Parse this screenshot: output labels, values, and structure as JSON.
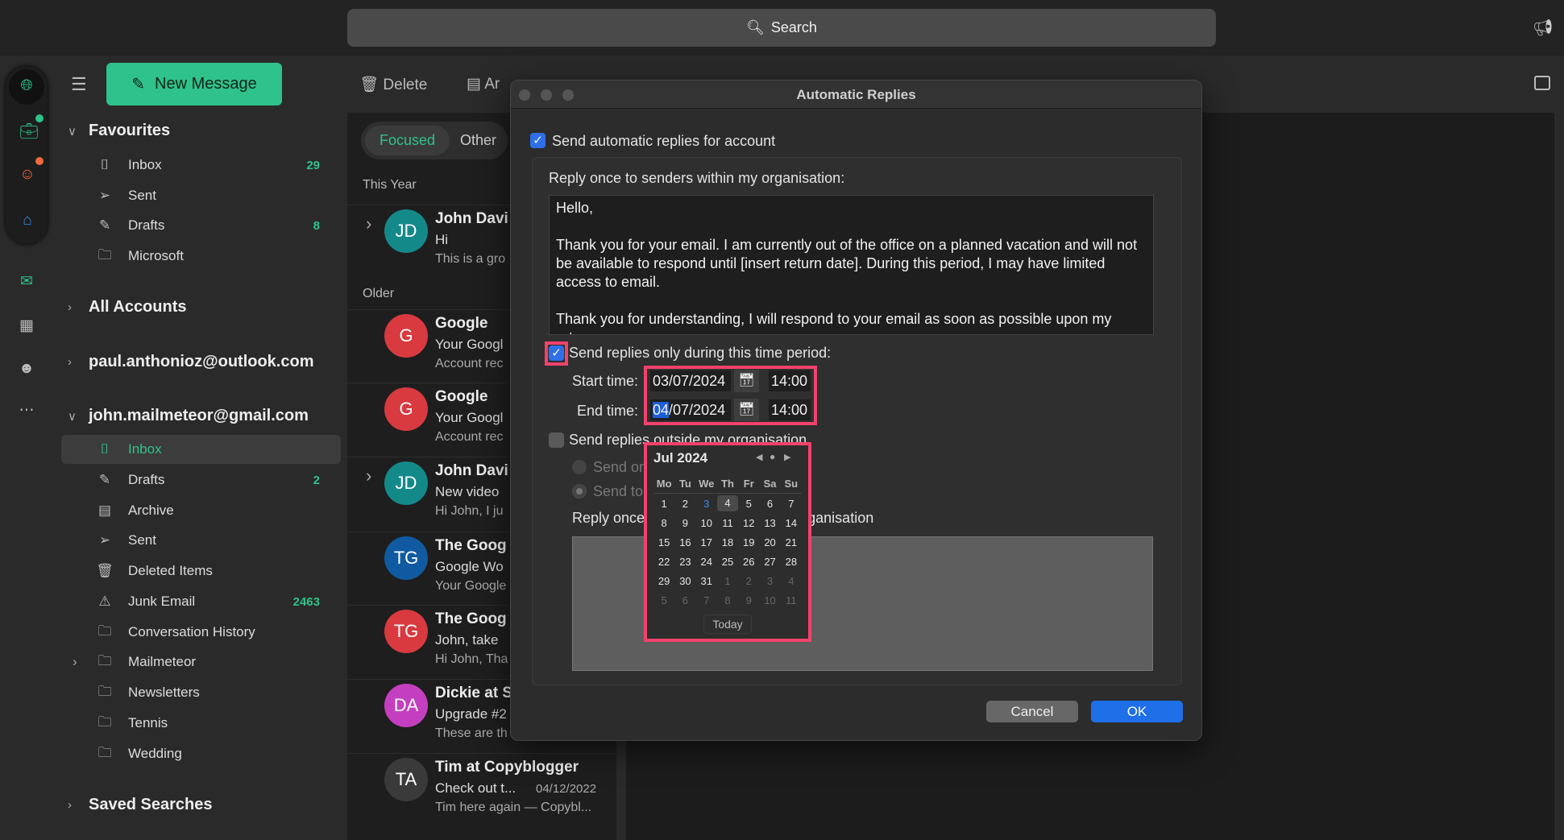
{
  "search": {
    "placeholder": "Search"
  },
  "rail": {
    "items": [
      "globe-icon",
      "briefcase-icon",
      "person-icon",
      "home-icon",
      "mail-icon",
      "calendar-icon",
      "people-icon",
      "more-icon"
    ]
  },
  "sidebar": {
    "new_message": "New Message",
    "favourites": {
      "label": "Favourites",
      "items": [
        {
          "label": "Inbox",
          "count": "29",
          "icon": "inbox-icon"
        },
        {
          "label": "Sent",
          "count": "",
          "icon": "sent-icon"
        },
        {
          "label": "Drafts",
          "count": "8",
          "icon": "drafts-icon"
        },
        {
          "label": "Microsoft",
          "count": "",
          "icon": "folder-icon"
        }
      ]
    },
    "all_accounts": "All Accounts",
    "account1": "paul.anthonioz@outlook.com",
    "account2": {
      "label": "john.mailmeteor@gmail.com",
      "items": [
        {
          "label": "Inbox",
          "count": "",
          "icon": "inbox-icon",
          "active": true
        },
        {
          "label": "Drafts",
          "count": "2",
          "icon": "drafts-icon"
        },
        {
          "label": "Archive",
          "count": "",
          "icon": "archive-icon"
        },
        {
          "label": "Sent",
          "count": "",
          "icon": "sent-icon"
        },
        {
          "label": "Deleted Items",
          "count": "",
          "icon": "trash-icon"
        },
        {
          "label": "Junk Email",
          "count": "2463",
          "icon": "junk-icon"
        },
        {
          "label": "Conversation History",
          "count": "",
          "icon": "folder-icon"
        },
        {
          "label": "Mailmeteor",
          "count": "",
          "icon": "folder-icon",
          "expandable": true
        },
        {
          "label": "Newsletters",
          "count": "",
          "icon": "folder-icon"
        },
        {
          "label": "Tennis",
          "count": "",
          "icon": "folder-icon"
        },
        {
          "label": "Wedding",
          "count": "",
          "icon": "folder-icon"
        }
      ]
    },
    "saved_searches": "Saved Searches"
  },
  "toolbar": {
    "delete": "Delete",
    "archive": "Ar"
  },
  "list": {
    "tabs": [
      "Focused",
      "Other"
    ],
    "sections": [
      "This Year",
      "Older"
    ],
    "messages": [
      {
        "initials": "JD",
        "color": "#14898a",
        "sender": "John Davi",
        "subject": "Hi",
        "preview": "This is a gro",
        "thread": true
      },
      {
        "initials": "G",
        "color": "#d83a3f",
        "sender": "Google",
        "subject": "Your Googl",
        "preview": "Account rec"
      },
      {
        "initials": "G",
        "color": "#d83a3f",
        "sender": "Google",
        "subject": "Your Googl",
        "preview": "Account rec"
      },
      {
        "initials": "JD",
        "color": "#14898a",
        "sender": "John Davi",
        "subject": "New video",
        "preview": "Hi John, I ju",
        "thread": true
      },
      {
        "initials": "TG",
        "color": "#0f5aa0",
        "sender": "The Goog",
        "subject": "Google Wo",
        "preview": "Your Google"
      },
      {
        "initials": "TG",
        "color": "#d83a3f",
        "sender": "The Goog",
        "subject": "John, take",
        "preview": "Hi John, Tha"
      },
      {
        "initials": "DA",
        "color": "#c43fbf",
        "sender": "Dickie at S",
        "subject": "Upgrade #2",
        "preview": "These are th"
      },
      {
        "initials": "TA",
        "color": "#3a3a3a",
        "sender": "Tim at Copyblogger",
        "subject": "Check out t...",
        "date": "04/12/2022",
        "preview": "Tim here again — Copybl..."
      }
    ]
  },
  "dialog": {
    "title": "Automatic Replies",
    "send_auto": "Send automatic replies for account",
    "send_auto_checked": true,
    "reply_inside_label": "Reply once to senders within my organisation:",
    "reply_inside_text": "Hello,\n\nThank you for your email. I am currently out of the office on a planned vacation and will not be available to respond until [insert return date]. During this period, I may have limited access to email.\n\nThank you for understanding, I will respond to your email as soon as possible upon my return.",
    "time_period": "Send replies only during this time period:",
    "time_period_checked": true,
    "start_label": "Start time:",
    "start_date": "03/07/2024",
    "start_time": "14:00",
    "end_label": "End time:",
    "end_date_selected": "04",
    "end_date_rest": "/07/2024",
    "end_time": "14:00",
    "outside": "Send replies outside my organisation",
    "outside_checked": false,
    "radio1": "Send only to my contacts",
    "radio2": "Send to all external senders",
    "reply_outside_label": "Reply once to senders outside my organisation",
    "cancel": "Cancel",
    "ok": "OK",
    "highlight_color": "#f2426c",
    "calendar": {
      "month": "Jul 2024",
      "weekdays": [
        "Mo",
        "Tu",
        "We",
        "Th",
        "Fr",
        "Sa",
        "Su"
      ],
      "weeks": [
        [
          "1",
          "2",
          "3",
          "4",
          "5",
          "6",
          "7"
        ],
        [
          "8",
          "9",
          "10",
          "11",
          "12",
          "13",
          "14"
        ],
        [
          "15",
          "16",
          "17",
          "18",
          "19",
          "20",
          "21"
        ],
        [
          "22",
          "23",
          "24",
          "25",
          "26",
          "27",
          "28"
        ],
        [
          "29",
          "30",
          "31",
          "1",
          "2",
          "3",
          "4"
        ],
        [
          "5",
          "6",
          "7",
          "8",
          "9",
          "10",
          "11"
        ]
      ],
      "today": "3",
      "selected": "4",
      "today_label": "Today"
    }
  }
}
